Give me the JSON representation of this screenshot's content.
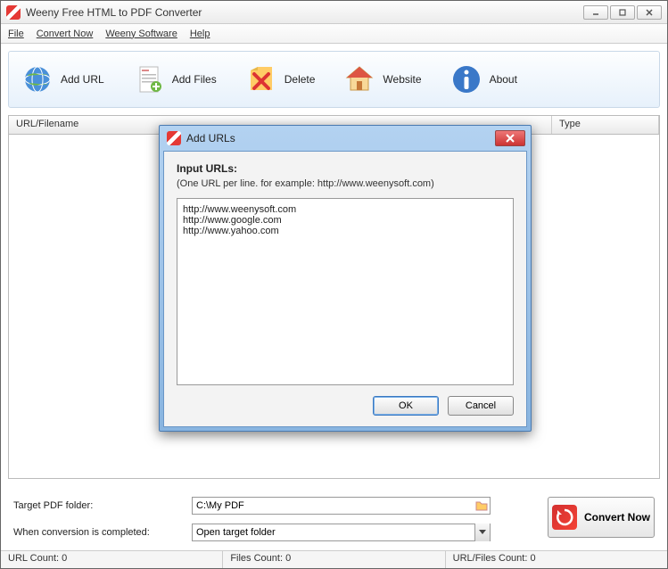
{
  "window": {
    "title": "Weeny Free HTML to PDF Converter"
  },
  "menu": {
    "file": "File",
    "convert": "Convert Now",
    "weeny": "Weeny Software",
    "help": "Help"
  },
  "toolbar": {
    "addurl": "Add URL",
    "addfiles": "Add Files",
    "delete": "Delete",
    "website": "Website",
    "about": "About"
  },
  "table": {
    "col_url": "URL/Filename",
    "col_type": "Type"
  },
  "form": {
    "target_label": "Target PDF folder:",
    "target_value": "C:\\My PDF",
    "complete_label": "When conversion is completed:",
    "complete_value": "Open target folder"
  },
  "convert_button": "Convert Now",
  "status": {
    "url_count": "URL Count: 0",
    "files_count": "Files Count: 0",
    "total_count": "URL/Files Count: 0"
  },
  "dialog": {
    "title": "Add URLs",
    "heading": "Input URLs:",
    "hint": "(One URL per line. for example: http://www.weenysoft.com)",
    "textarea_value": "http://www.weenysoft.com\nhttp://www.google.com\nhttp://www.yahoo.com",
    "ok": "OK",
    "cancel": "Cancel"
  }
}
